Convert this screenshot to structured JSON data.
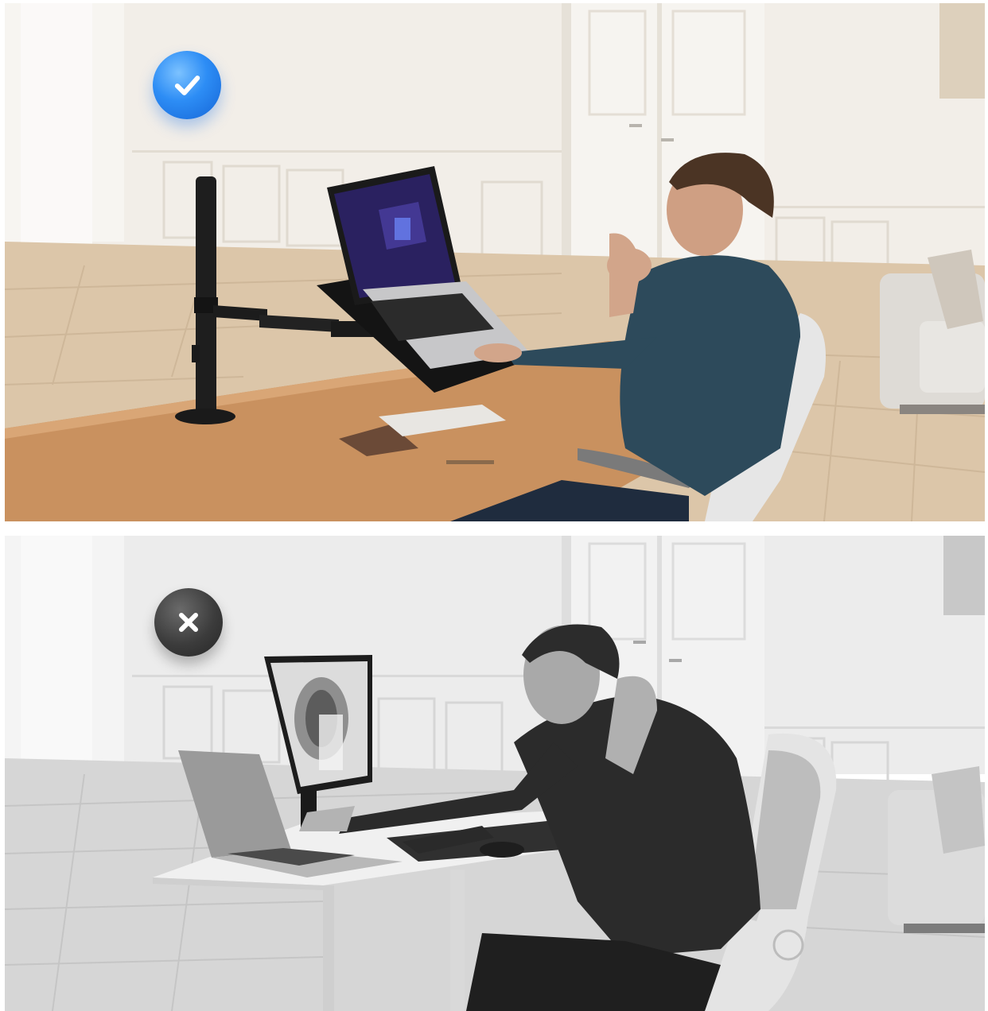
{
  "scenes": [
    {
      "id": "good-posture",
      "mood": "color",
      "badge_icon": "checkmark-icon",
      "badge_color": "#2d8df5"
    },
    {
      "id": "bad-posture",
      "mood": "grayscale",
      "badge_icon": "cross-icon",
      "badge_color": "#333333"
    }
  ],
  "colors": {
    "floor_wood": "#d9c4a8",
    "desk_top": "#c99468",
    "wall": "#f1ede6",
    "shirt": "#2e4a5a",
    "gray_wall": "#e9e9e9"
  }
}
